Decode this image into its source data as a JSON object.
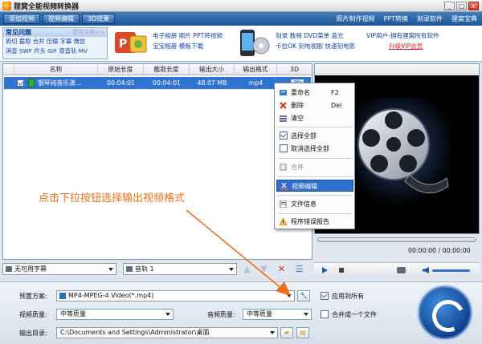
{
  "window": {
    "title": "狸窝全能视频转换器",
    "controls": [
      "_",
      "□",
      "×"
    ]
  },
  "toolbar": {
    "buttons": [
      "添加视频",
      "视频编辑",
      "3D效果"
    ],
    "links": [
      "照片制作视频",
      "PPT转换",
      "刻录软件",
      "狸窝宝典"
    ]
  },
  "banner": {
    "faq_title": "常见问题",
    "faq_more": "狸窝宝典>>",
    "faq_rows": [
      "剪切 截取 合并 压缩 字幕 微信",
      "消音 SWF 片头 GIF 双音轨 MV"
    ],
    "promo1": [
      "电子相册 照片 PPT转视频",
      "宝宝相册 模板下载"
    ],
    "promo2": [
      "刻录 教程 DVD菜单 蓝光",
      "卡拉OK 刻电视剧 快速刻电影"
    ],
    "vip": [
      "VIP用户-拥有狸窝所有软件",
      "升级VIP会员"
    ]
  },
  "table": {
    "headers": [
      "名称",
      "原始长度",
      "截取长度",
      "输出大小",
      "输出格式",
      "3D"
    ],
    "rows": [
      {
        "name": "钢琴纯音乐演...",
        "original": "00:04:01",
        "clip": "00:04:01",
        "size": "48.07 MB",
        "format": "mp4",
        "d3": "3D"
      }
    ]
  },
  "context_menu": {
    "items": [
      {
        "label": "重命名",
        "shortcut": "F2"
      },
      {
        "label": "删除",
        "shortcut": "Del"
      },
      {
        "label": "清空",
        "shortcut": ""
      },
      {
        "label": "选择全部",
        "shortcut": ""
      },
      {
        "label": "取消选择全部",
        "shortcut": ""
      },
      {
        "label": "合并",
        "shortcut": ""
      },
      {
        "label": "视频编辑",
        "shortcut": ""
      },
      {
        "label": "文件信息",
        "shortcut": ""
      },
      {
        "label": "程序错误报告",
        "shortcut": ""
      }
    ]
  },
  "subbar": {
    "subtitle": "无可用字幕",
    "audio": "音轨 1"
  },
  "player": {
    "time": "00:00:00 / 00:00:00"
  },
  "settings": {
    "preset_label": "预置方案:",
    "preset_value": "MP4-MPEG-4 Video(*.mp4)",
    "apply_all": "应用到所有",
    "merge": "合并成一个文件",
    "video_quality_label": "视频质量:",
    "video_quality_value": "中等质量",
    "audio_quality_label": "音频质量:",
    "audio_quality_value": "中等质量",
    "output_label": "输出目录:",
    "output_value": "C:\\Documents and Settings\\Administrator\\桌面"
  },
  "annotation": "点击下拉按钮选择输出视频格式",
  "colors": {
    "accent": "#3074d3",
    "annotation": "#f06f16",
    "toolbar": "#2d67aa"
  }
}
